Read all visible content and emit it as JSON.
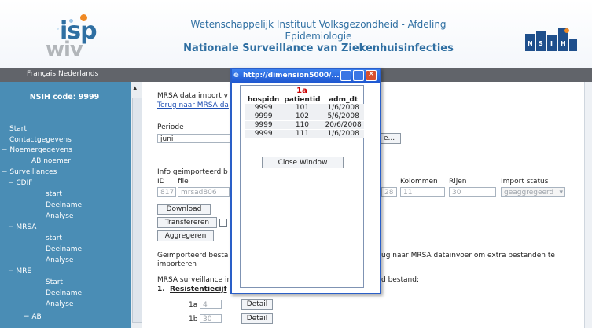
{
  "header": {
    "logo_top": "isp",
    "logo_bottom": "wiv",
    "title_line1": "Wetenschappelijk Instituut Volksgezondheid - Afdeling",
    "title_line2": "Epidemiologie",
    "title_line3": "Nationale Surveillance van Ziekenhuisinfecties",
    "nsih_letters": [
      "N",
      "S",
      "I",
      "H"
    ],
    "colors": {
      "brand_blue": "#2f6fa2",
      "accent_orange": "#f08a24",
      "sidebar": "#4a8db5"
    }
  },
  "navbar": {
    "languages": "Français Nederlands"
  },
  "sidebar": {
    "code": "NSIH code: 9999",
    "items": [
      {
        "label": "Start"
      },
      {
        "label": "Contactgegevens"
      },
      {
        "label": "− Noemergegevens"
      },
      {
        "label": "AB noemer"
      },
      {
        "label": "− Surveillances"
      },
      {
        "label": "− CDIF"
      },
      {
        "label": "start"
      },
      {
        "label": "Deelname"
      },
      {
        "label": "Analyse"
      },
      {
        "label": "− MRSA"
      },
      {
        "label": "start"
      },
      {
        "label": "Deelname"
      },
      {
        "label": "Analyse"
      },
      {
        "label": "− MRE"
      },
      {
        "label": "Start"
      },
      {
        "label": "Deelname"
      },
      {
        "label": "Analyse"
      },
      {
        "label": "− AB"
      }
    ]
  },
  "content": {
    "import_title": "MRSA data import v",
    "back_link": "Terug naar MRSA da",
    "periode_label": "Periode",
    "periode_value": "juni",
    "e_button": "e...",
    "info_label": "Info geimporteerd b",
    "col_id": "ID",
    "col_file": "file",
    "col_kolommen": "Kolommen",
    "col_rijen": "Rijen",
    "col_import_status": "Import status",
    "row_id": "817",
    "row_file": "mrsad806",
    "row_mid": "28",
    "row_kolommen": "11",
    "row_rijen": "30",
    "row_status": "geaggregeerd",
    "btn_download": "Download",
    "btn_transfereren": "Transfereren",
    "btn_aggregeren": "Aggregeren",
    "geimporteerd_left": "Geimporteerd besta",
    "geimporteerd_right": "ug naar MRSA datainvoer om extra bestanden te",
    "importeren": "importeren",
    "surveillance_left": "MRSA surveillance ir",
    "surveillance_right": "d bestand:",
    "section_num": "1.",
    "section_title": "Resistentiecijf",
    "rows": [
      {
        "label": "1a",
        "value": "4",
        "detail": "Detail"
      },
      {
        "label": "1b",
        "value": "30",
        "detail": "Detail"
      }
    ]
  },
  "popup": {
    "title": "http://dimension5000/...",
    "heading": "1a",
    "columns": [
      "hospidn",
      "patientid",
      "adm_dt"
    ],
    "rows": [
      [
        "9999",
        "101",
        "1/6/2008"
      ],
      [
        "9999",
        "102",
        "5/6/2008"
      ],
      [
        "9999",
        "110",
        "20/6/2008"
      ],
      [
        "9999",
        "111",
        "1/6/2008"
      ]
    ],
    "close_label": "Close Window"
  }
}
